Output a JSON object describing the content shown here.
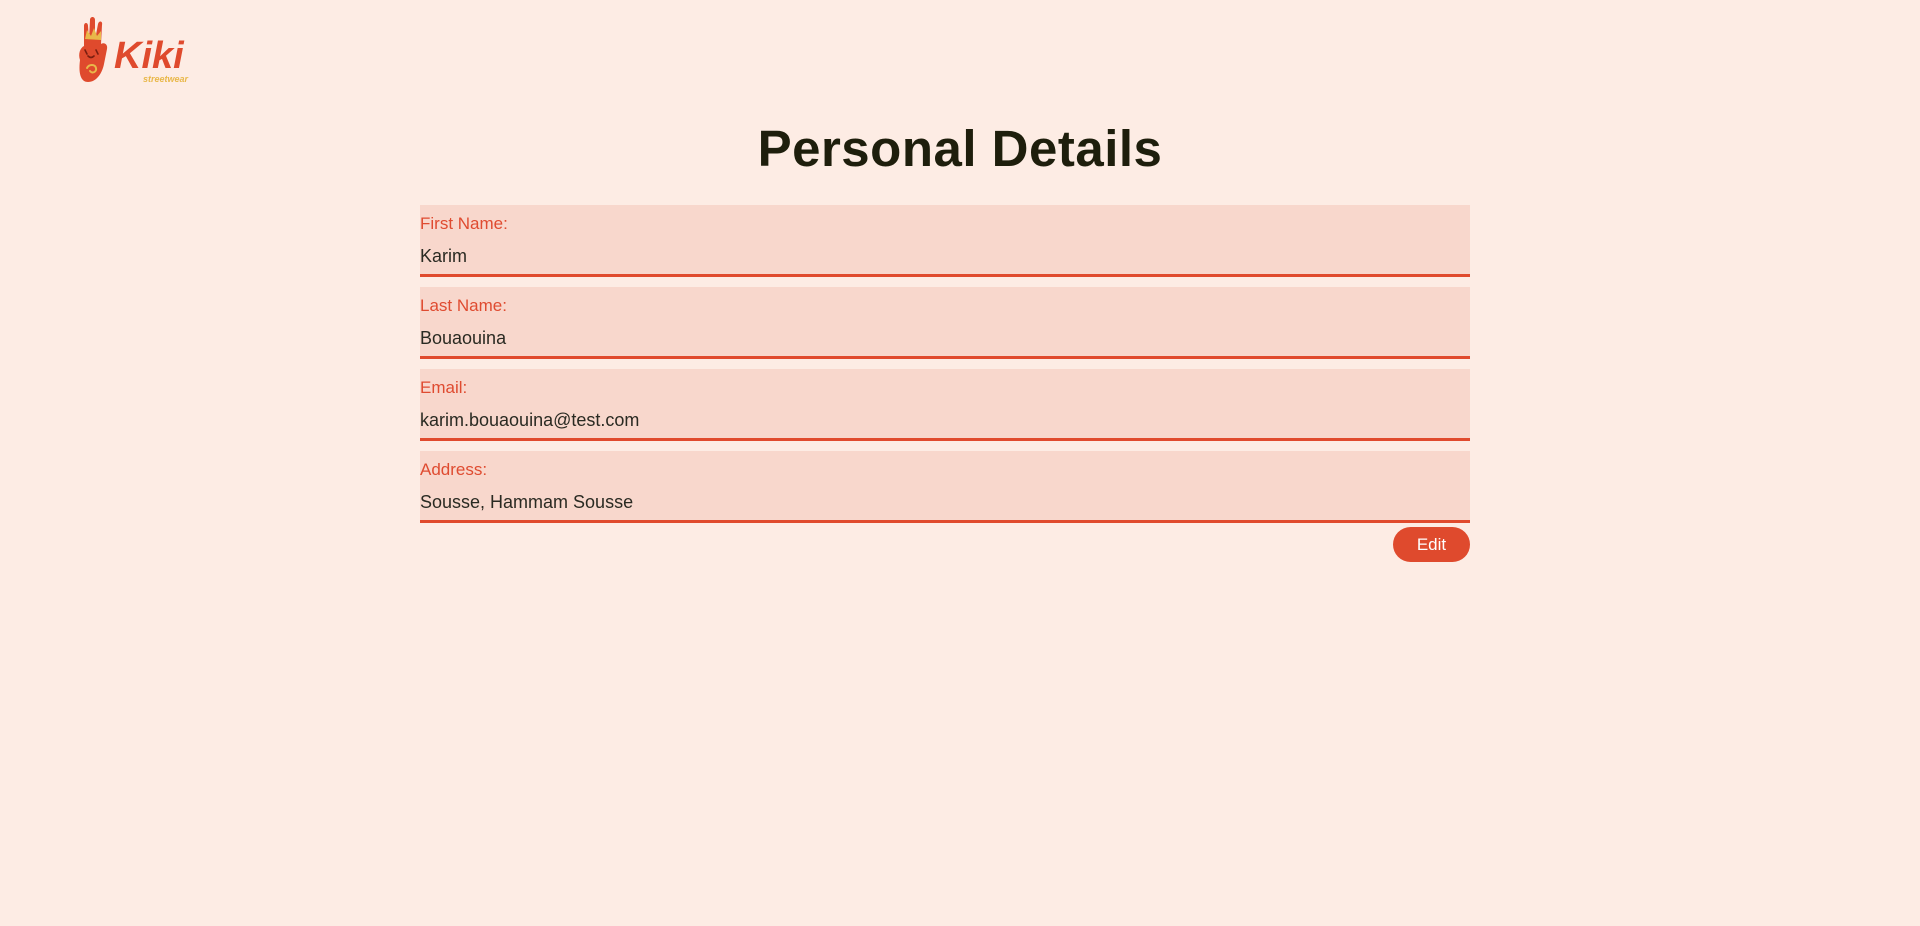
{
  "logo": {
    "name": "Kiki",
    "tagline": "streetwear",
    "icon": "kiki-hand-crown-logo",
    "colors": {
      "red": "#df4a2d",
      "gold": "#e9b84a"
    }
  },
  "page": {
    "title": "Personal Details",
    "background": "#fdece4"
  },
  "form": {
    "fields": [
      {
        "label": "First Name:",
        "value": "Karim"
      },
      {
        "label": "Last Name:",
        "value": "Bouaouina"
      },
      {
        "label": "Email:",
        "value": "karim.bouaouina@test.com"
      },
      {
        "label": "Address:",
        "value": "Sousse, Hammam Sousse"
      }
    ],
    "field_background": "#f8d7cc",
    "accent": "#df4a2d",
    "edit_label": "Edit"
  }
}
